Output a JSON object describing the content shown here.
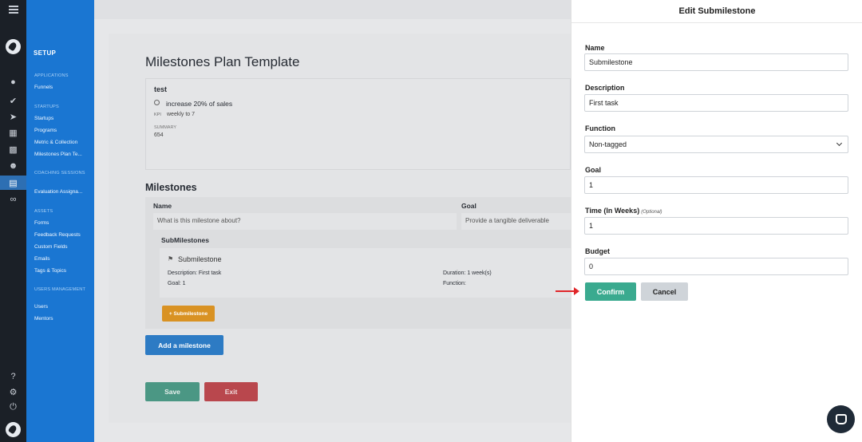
{
  "rail": {
    "icons": [
      "menu-icon",
      "logo-icon",
      "user-icon",
      "check-circle-icon",
      "rocket-icon",
      "calendar-icon",
      "gift-icon",
      "team-icon",
      "milestones-icon",
      "link-icon",
      "help-icon",
      "settings-icon",
      "power-icon",
      "logo-icon"
    ]
  },
  "nav": {
    "setup": "SETUP",
    "sections": {
      "applications": "APPLICATIONS",
      "startups": "STARTUPS",
      "coaching": "COACHING SESSIONS",
      "assets": "ASSETS",
      "users": "USERS MANAGEMENT"
    },
    "items": {
      "funnels": "Funnels",
      "startups": "Startups",
      "programs": "Programs",
      "metric": "Metric & Collection",
      "milestones": "Milestones Plan Te...",
      "evaluation": "Evaluation Assigna...",
      "forms": "Forms",
      "feedback": "Feedback Requests",
      "custom_fields": "Custom Fields",
      "emails": "Emails",
      "tags": "Tags & Topics",
      "users": "Users",
      "mentors": "Mentors"
    }
  },
  "main": {
    "title": "Milestones Plan Template",
    "plan": {
      "name": "test",
      "goal": "increase 20% of sales",
      "kpi_label": "KPI",
      "kpi_value": "weekly to 7",
      "summary_label": "SUMMARY",
      "summary_value": "654"
    },
    "milestones_title": "Milestones",
    "table": {
      "col_name": "Name",
      "col_goal": "Goal",
      "name_placeholder": "What is this milestone about?",
      "goal_placeholder": "Provide a tangible deliverable"
    },
    "submilestones": {
      "title": "SubMilestones",
      "name": "Submilestone",
      "description": "Description: First task",
      "goal": "Goal: 1",
      "duration": "Duration: 1 week(s)",
      "function": "Function:"
    },
    "add_sub_label": "+ Submilestone",
    "add_milestone_label": "Add a milestone",
    "save_label": "Save",
    "exit_label": "Exit"
  },
  "drawer": {
    "title": "Edit Submilestone",
    "name_label": "Name",
    "name_value": "Submilestone",
    "desc_label": "Description",
    "desc_value": "First task",
    "function_label": "Function",
    "function_value": "Non-tagged",
    "goal_label": "Goal",
    "goal_value": "1",
    "time_label": "Time (In Weeks)",
    "time_optional": "(Optional)",
    "time_value": "1",
    "budget_label": "Budget",
    "budget_value": "0",
    "confirm_label": "Confirm",
    "cancel_label": "Cancel"
  },
  "colors": {
    "rail": "#1b2027",
    "nav": "#1a76d2",
    "confirm": "#3aaa8f",
    "annotation_arrow": "#e0262a"
  }
}
